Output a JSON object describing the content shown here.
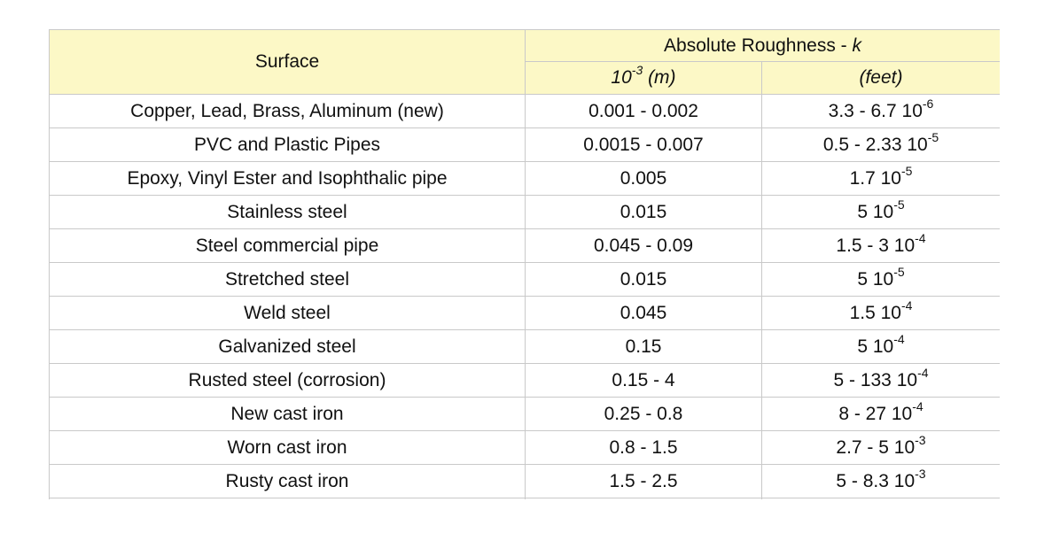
{
  "table": {
    "header": {
      "surface": "Surface",
      "group": "Absolute Roughness - ",
      "group_symbol": "k",
      "col_m_base": "10",
      "col_m_exp": "-3",
      "col_m_unit": " (m)",
      "col_ft": "(feet)"
    },
    "rows": [
      {
        "surface": "Copper, Lead, Brass, Aluminum (new)",
        "m": "0.001 - 0.002",
        "ft_base": "3.3 - 6.7 10",
        "ft_exp": "-6"
      },
      {
        "surface": "PVC and Plastic Pipes",
        "m": "0.0015 - 0.007",
        "ft_base": "0.5 - 2.33 10",
        "ft_exp": "-5"
      },
      {
        "surface": "Epoxy, Vinyl Ester and Isophthalic pipe",
        "m": "0.005",
        "ft_base": "1.7 10",
        "ft_exp": "-5"
      },
      {
        "surface": "Stainless steel",
        "m": "0.015",
        "ft_base": "5 10",
        "ft_exp": "-5"
      },
      {
        "surface": "Steel commercial pipe",
        "m": "0.045 - 0.09",
        "ft_base": "1.5 - 3 10",
        "ft_exp": "-4"
      },
      {
        "surface": "Stretched steel",
        "m": "0.015",
        "ft_base": "5 10",
        "ft_exp": "-5"
      },
      {
        "surface": "Weld steel",
        "m": "0.045",
        "ft_base": "1.5 10",
        "ft_exp": "-4"
      },
      {
        "surface": "Galvanized steel",
        "m": "0.15",
        "ft_base": "5 10",
        "ft_exp": "-4"
      },
      {
        "surface": "Rusted steel (corrosion)",
        "m": "0.15 - 4",
        "ft_base": "5 - 133 10",
        "ft_exp": "-4"
      },
      {
        "surface": "New cast iron",
        "m": "0.25 - 0.8",
        "ft_base": "8 - 27 10",
        "ft_exp": "-4"
      },
      {
        "surface": "Worn cast iron",
        "m": "0.8 - 1.5",
        "ft_base": "2.7 - 5 10",
        "ft_exp": "-3"
      },
      {
        "surface": "Rusty cast iron",
        "m": "1.5 - 2.5",
        "ft_base": "5 - 8.3 10",
        "ft_exp": "-3"
      },
      {
        "surface": "",
        "m": "",
        "ft_base": "",
        "ft_exp": ""
      }
    ]
  }
}
